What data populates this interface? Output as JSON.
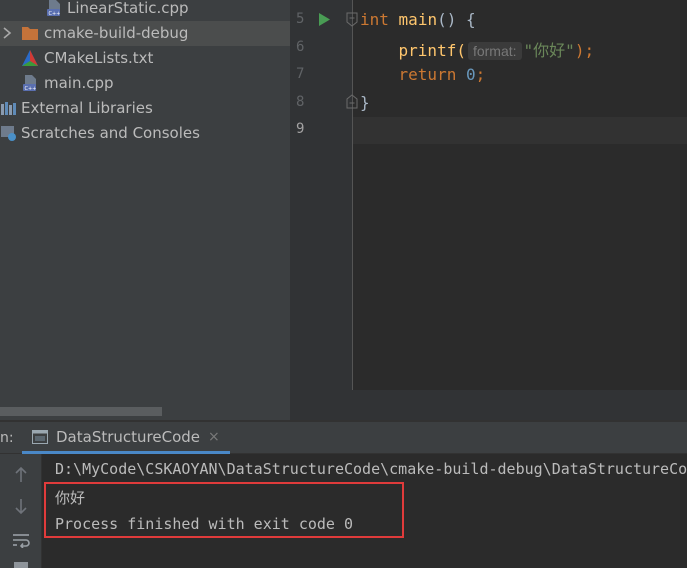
{
  "project_tree": {
    "items": [
      {
        "label": "LinearStatic.cpp",
        "icon": "cpp-file-icon"
      },
      {
        "label": "cmake-build-debug",
        "icon": "folder-icon",
        "expandable": true,
        "selected": true
      },
      {
        "label": "CMakeLists.txt",
        "icon": "cmake-icon"
      },
      {
        "label": "main.cpp",
        "icon": "cpp-file-icon"
      },
      {
        "label": "External Libraries",
        "icon": "libraries-icon"
      },
      {
        "label": "Scratches and Consoles",
        "icon": "scratches-icon"
      }
    ]
  },
  "editor": {
    "line_numbers": [
      "5",
      "6",
      "7",
      "8",
      "9"
    ],
    "current_line": "9",
    "code": {
      "line5": {
        "kw": "int",
        "fn": "main",
        "rest": "() {"
      },
      "line6": {
        "fn": "printf(",
        "hint": "format:",
        "str": "\"你好\"",
        "end": ");"
      },
      "line7": {
        "kw": "return",
        "num": "0",
        "end": ";"
      },
      "line8": {
        "brace": "}"
      }
    }
  },
  "run_panel": {
    "prefix": "n:",
    "tab_label": "DataStructureCode",
    "close_glyph": "×",
    "console_lines": [
      "D:\\MyCode\\CSKAOYAN\\DataStructureCode\\cmake-build-debug\\DataStructureCode.exe",
      "你好",
      "Process finished with exit code 0"
    ]
  },
  "colors": {
    "keyword": "#cc7832",
    "function": "#ffc66d",
    "number": "#6897bb",
    "string": "#6a8759",
    "highlight_box": "#e03b3b",
    "run_icon": "#499c54"
  }
}
